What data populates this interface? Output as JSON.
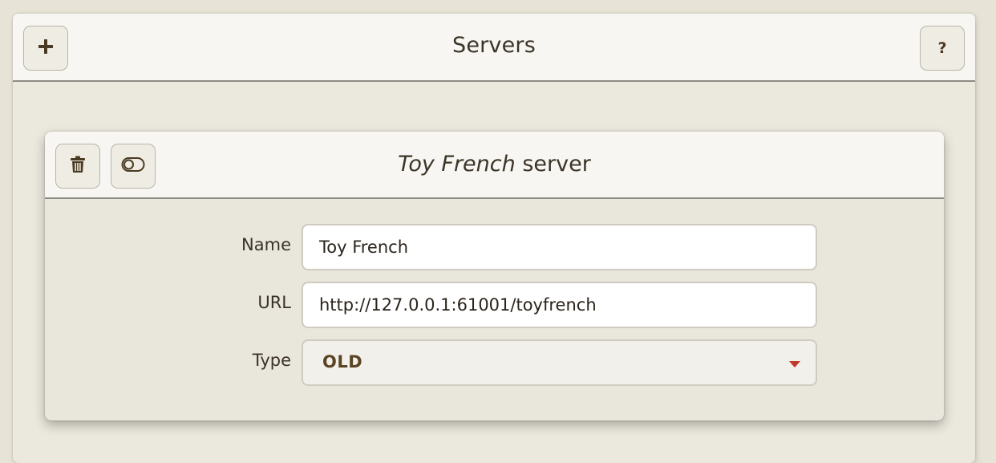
{
  "header": {
    "title": "Servers",
    "add_button": {
      "icon": "plus-icon",
      "glyph": "+"
    },
    "help_button": {
      "icon": "question-icon",
      "glyph": "?"
    }
  },
  "server_card": {
    "title_italic": "Toy French",
    "title_suffix": "server",
    "delete_button": {
      "icon": "trash-icon"
    },
    "toggle_button": {
      "icon": "toggle-icon"
    },
    "fields": {
      "name": {
        "label": "Name",
        "value": "Toy French"
      },
      "url": {
        "label": "URL",
        "value": "http://127.0.0.1:61001/toyfrench"
      },
      "type": {
        "label": "Type",
        "value": "OLD"
      }
    }
  },
  "colors": {
    "background": "#e7e4d7",
    "header_bg": "#f7f6f2",
    "header_border": "#8e8b84",
    "text": "#3c3427",
    "select_value": "#5b4424",
    "caret": "#c0392b"
  }
}
